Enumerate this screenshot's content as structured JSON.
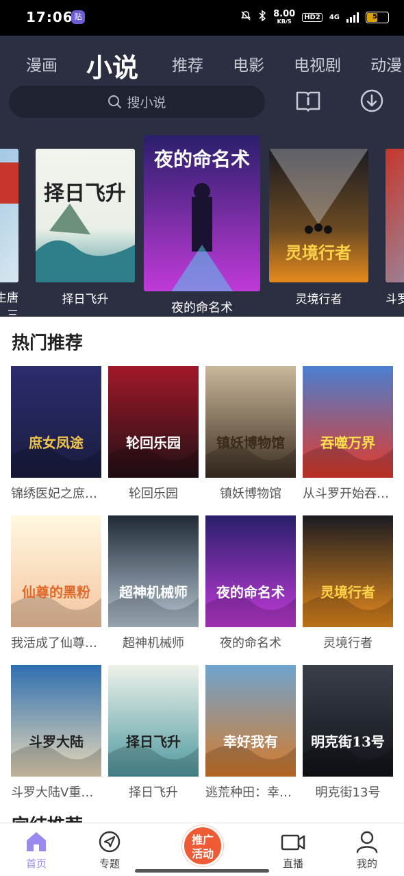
{
  "status_bar": {
    "time": "17:06",
    "app_badge": "贴",
    "net_speed_value": "8.00",
    "net_speed_unit": "KB/S",
    "hd_label": "HD2",
    "network": "4G",
    "battery": "54",
    "battery_level": 0.54,
    "icons": [
      "mute-bell-icon",
      "bluetooth-icon",
      "signal-icon",
      "battery-icon"
    ]
  },
  "tabs": [
    {
      "label": "漫画",
      "active": false
    },
    {
      "label": "小说",
      "active": true
    },
    {
      "label": "推荐",
      "active": false
    },
    {
      "label": "电影",
      "active": false
    },
    {
      "label": "电视剧",
      "active": false
    },
    {
      "label": "动漫",
      "active": false
    }
  ],
  "search": {
    "placeholder": "搜小说",
    "icon": "search-icon"
  },
  "header_buttons": [
    {
      "name": "bookshelf-button",
      "icon": "book-icon"
    },
    {
      "name": "download-button",
      "icon": "download-icon"
    }
  ],
  "carousel": [
    {
      "title": "斗罗大陆V重生唐三",
      "color1": "#7fb3d8",
      "color2": "#d8e7f0"
    },
    {
      "title": "择日飞升",
      "color1": "#e9efe6",
      "color2": "#4f9aa0"
    },
    {
      "title": "夜的命名术",
      "color1": "#2a1f6b",
      "color2": "#c03ad8"
    },
    {
      "title": "灵境行者",
      "color1": "#1b1b22",
      "color2": "#e58a1d"
    },
    {
      "title": "斗罗大陆",
      "color1": "#c7362c",
      "color2": "#7fb3d8"
    }
  ],
  "section_hot": {
    "title": "热门推荐",
    "books": [
      {
        "title": "锦绣医妃之庶女凤途",
        "cover_text": "庶女凤途",
        "color1": "#2b2d6e",
        "color2": "#1a1c3f",
        "text_color": "#f0c44b"
      },
      {
        "title": "轮回乐园",
        "cover_text": "轮回乐园",
        "color1": "#a1192a",
        "color2": "#231015",
        "text_color": "#ffffff"
      },
      {
        "title": "镇妖博物馆",
        "cover_text": "镇妖博物馆",
        "color1": "#c9b79a",
        "color2": "#3d2f22",
        "text_color": "#3a2a1a"
      },
      {
        "title": "从斗罗开始吞噬万界",
        "cover_text": "吞噬万界",
        "color1": "#4a7fd1",
        "color2": "#e23a2a",
        "text_color": "#ffe14a"
      },
      {
        "title": "我活成了仙尊的黑粉",
        "cover_text": "仙尊的黑粉",
        "color1": "#fff8e0",
        "color2": "#f5c5a0",
        "text_color": "#e06a2a"
      },
      {
        "title": "超神机械师",
        "cover_text": "超神机械师",
        "color1": "#1f2a36",
        "color2": "#b7c6d4",
        "text_color": "#ffffff"
      },
      {
        "title": "夜的命名术",
        "cover_text": "夜的命名术",
        "color1": "#2a1f6b",
        "color2": "#c03ad8",
        "text_color": "#ffffff"
      },
      {
        "title": "灵境行者",
        "cover_text": "灵境行者",
        "color1": "#1b1b22",
        "color2": "#e58a1d",
        "text_color": "#ffd24a"
      },
      {
        "title": "斗罗大陆V重生唐三",
        "cover_text": "斗罗大陆",
        "color1": "#2e6fb0",
        "color2": "#e9d9b8",
        "text_color": "#222222"
      },
      {
        "title": "择日飞升",
        "cover_text": "择日飞升",
        "color1": "#eef2ea",
        "color2": "#4f9aa0",
        "text_color": "#222222"
      },
      {
        "title": "逃荒种田：幸好我有",
        "cover_text": "幸好我有",
        "color1": "#6fa4cf",
        "color2": "#d67a2a",
        "text_color": "#ffffff"
      },
      {
        "title": "明克街13号",
        "cover_text": "明克街13号",
        "color1": "#3a3f4a",
        "color2": "#111318",
        "text_color": "#ffffff"
      }
    ]
  },
  "section_finished": {
    "title": "完结推荐"
  },
  "bottom_nav": [
    {
      "label": "首页",
      "icon": "home-icon",
      "active": true
    },
    {
      "label": "专题",
      "icon": "compass-icon",
      "active": false
    },
    {
      "label": "推广活动",
      "icon": "promo-icon",
      "active": false
    },
    {
      "label": "直播",
      "icon": "video-camera-icon",
      "active": false
    },
    {
      "label": "我的",
      "icon": "profile-icon",
      "active": false
    }
  ],
  "promo": {
    "line1": "推广",
    "line2": "活动"
  }
}
